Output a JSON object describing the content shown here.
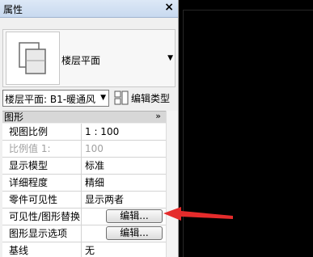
{
  "palette": {
    "title": "属性",
    "close_icon": "close-icon"
  },
  "type_selector": {
    "name": "楼层平面",
    "dropdown_icon": "chevron-down-icon"
  },
  "instance_selector": {
    "value": "楼层平面: B1-暖通风",
    "edit_type_label": "编辑类型"
  },
  "section": {
    "label": "图形",
    "collapse_icon": "double-chevron-up-icon"
  },
  "properties": [
    {
      "name": "视图比例",
      "value": "1 : 100"
    },
    {
      "name": "比例值 1:",
      "value": "100"
    },
    {
      "name": "显示模型",
      "value": "标准"
    },
    {
      "name": "详细程度",
      "value": "精细"
    },
    {
      "name": "零件可见性",
      "value": "显示两者"
    },
    {
      "name": "可见性/图形替换",
      "button": "编辑..."
    },
    {
      "name": "图形显示选项",
      "button": "编辑..."
    },
    {
      "name": "基线",
      "value": "无"
    }
  ],
  "colors": {
    "arrow": "#e52b2b",
    "viewport": "#000000",
    "panel": "#f0f0f0"
  }
}
